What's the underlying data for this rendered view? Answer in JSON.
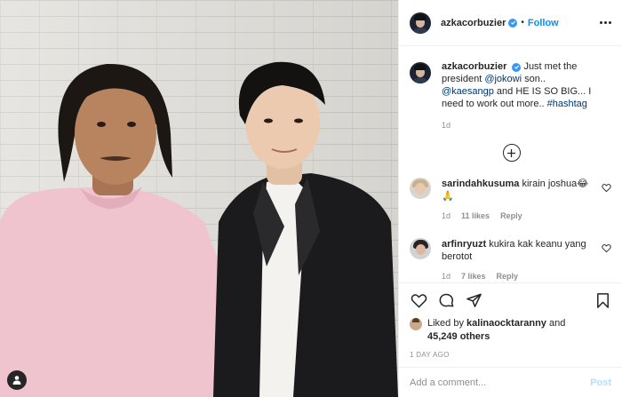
{
  "header": {
    "username": "azkacorbuzier",
    "separator": "•",
    "follow_label": "Follow"
  },
  "caption": {
    "username": "azkacorbuzier",
    "text_before": "Just met the president ",
    "mention1": "@jokowi",
    "text_mid": " son.. ",
    "mention2": "@kaesangp",
    "text_after": " and HE IS SO BIG... I need to work out more.. ",
    "hashtag": "#hashtag",
    "time": "1d"
  },
  "comments": [
    {
      "username": "sarindahkusuma",
      "text": "kirain joshua😂🙏",
      "time": "1d",
      "likes": "11 likes",
      "reply": "Reply"
    },
    {
      "username": "arfinryuzt",
      "text": "kukira kak keanu yang berotot",
      "time": "1d",
      "likes": "7 likes",
      "reply": "Reply"
    }
  ],
  "likes": {
    "prefix": "Liked by ",
    "user": "kalinaocktaranny",
    "middle": " and",
    "count": "45,249 others"
  },
  "post_date": "1 DAY AGO",
  "add_comment": {
    "placeholder": "Add a comment...",
    "post_label": "Post"
  },
  "colors": {
    "link_blue": "#0095f6",
    "verified_blue": "#3897f0",
    "post_disabled": "#b2dffc",
    "border": "#efefef",
    "muted": "#8e8e8e"
  }
}
